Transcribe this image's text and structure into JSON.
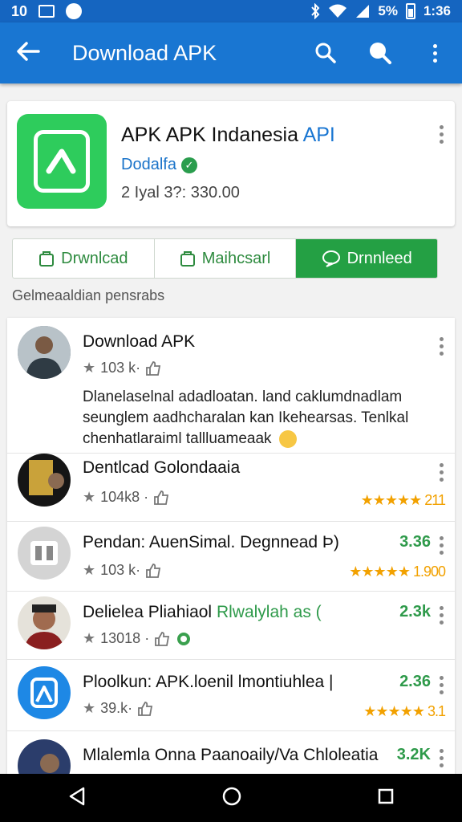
{
  "status_bar": {
    "left_text": "10",
    "time": "1:36",
    "battery_text": "5%"
  },
  "app_bar": {
    "title": "Download APK"
  },
  "app_card": {
    "name": "APK APK Indanesia",
    "name_accent": "API",
    "developer": "Dodalfa",
    "meta": "2 Iyal 3?: 330.00"
  },
  "actions": [
    {
      "label": "Drwnlcad",
      "icon": "bag-icon"
    },
    {
      "label": "Maihcsarl",
      "icon": "bag-icon"
    },
    {
      "label": "Drnnleed",
      "icon": "chat-icon"
    }
  ],
  "section_label": "Gelmeaaldian pensrabs",
  "list": [
    {
      "title": "Download APK",
      "stats": "103 k·",
      "description": "Dlanelaselnal adadloatan. land caklumdnadlam seunglem aadhcharalan kan Ikehearsas. Tenlkal chenhatlaraiml tallluameaak"
    },
    {
      "title": "Dentlcad Golondaaia",
      "stats": "104k8 ·",
      "rating": "★★★★★ 211"
    },
    {
      "title": "Pendan: AuenSimal. Degnnead  Þ)",
      "stats": "103 k·",
      "score": "3.36",
      "rating": "★★★★★ 1.900"
    },
    {
      "title": "Delielea Pliahiaol",
      "title_green": "Rlwalylah as (",
      "stats": "13018 ·",
      "score": "2.3k"
    },
    {
      "title": "Ploolkun: APK.loenil lmontiuhlea |",
      "stats": "39.k·",
      "score": "2.36",
      "rating": "★★★★★ 3.1"
    },
    {
      "title": "Mlalemla Onna Paanoaily/Va Chloleatia",
      "score": "3.2K"
    }
  ],
  "colors": {
    "primary": "#1976d2",
    "accent_green": "#24a044",
    "star": "#f2a100"
  }
}
